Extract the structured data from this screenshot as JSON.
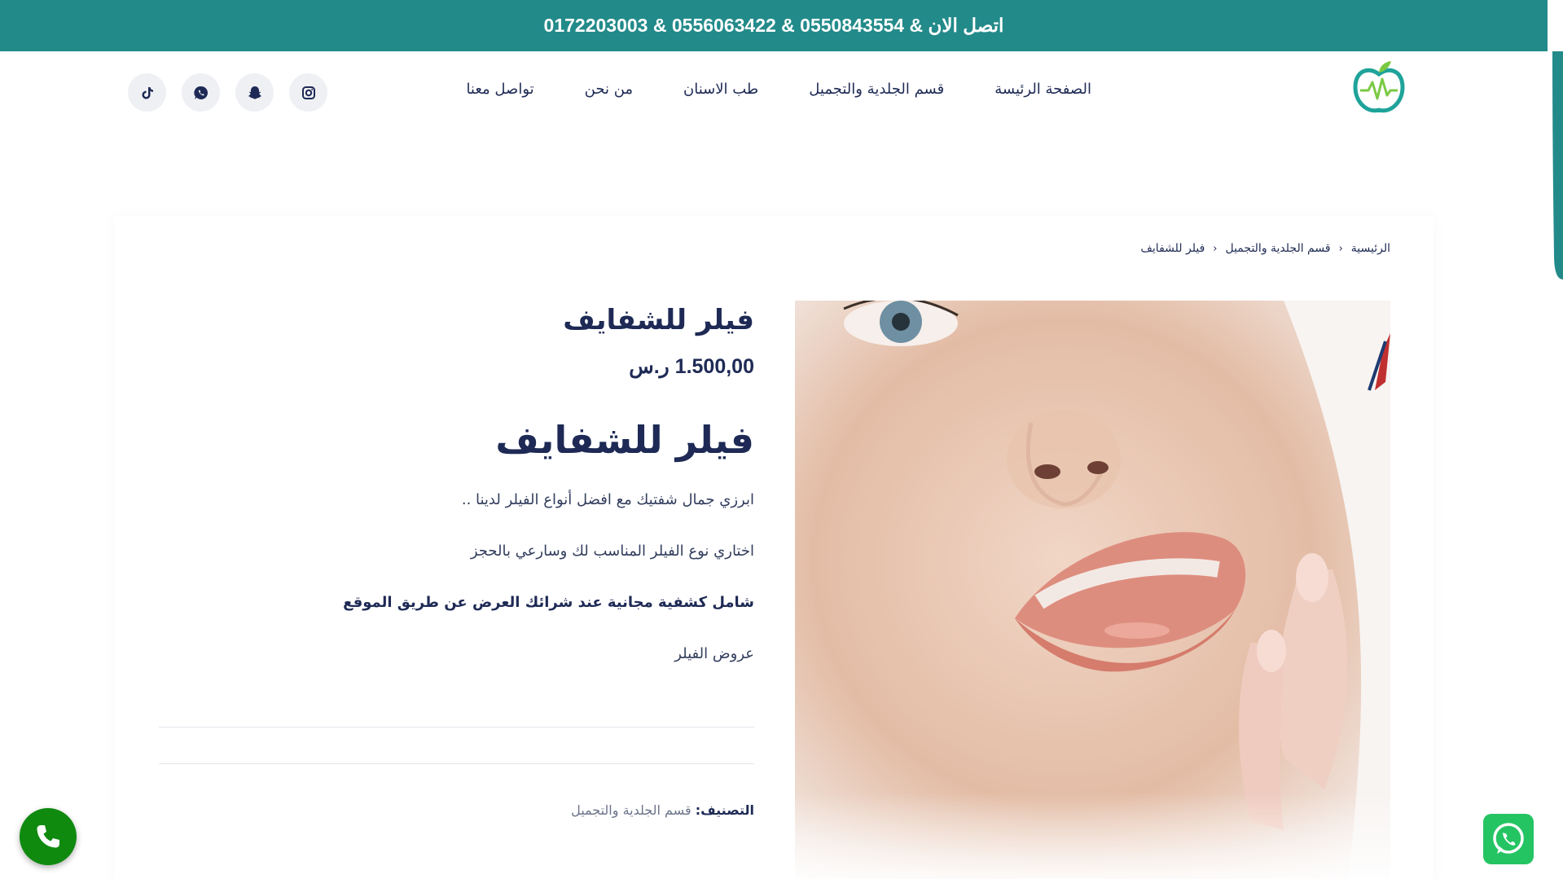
{
  "topbar": {
    "contact_text": "اتصل الان &  0550843554 &  0556063422  &  0172203003"
  },
  "header": {
    "logo_icon": "apple-heartbeat-logo-icon",
    "nav": [
      {
        "label": "الصفحة الرئيسة"
      },
      {
        "label": "قسم الجلدية والتجميل"
      },
      {
        "label": "طب الاسنان"
      },
      {
        "label": "من نحن"
      },
      {
        "label": "تواصل معنا"
      }
    ],
    "socials": [
      "instagram-icon",
      "snapchat-icon",
      "whatsapp-icon",
      "tiktok-icon"
    ]
  },
  "breadcrumb": {
    "home": "الرئيسية",
    "category": "قسم الجلدية والتجميل",
    "current": "فيلر للشفايف"
  },
  "product": {
    "title": "فيلر للشفايف",
    "price": "1.500,00 ر.س",
    "subtitle": "فيلر للشفايف",
    "paragraphs": [
      "ابرزي جمال شفتيك مع افضل أنواع الفيلر لدينا ..",
      "اختاري نوع الفيلر المناسب لك وسارعي بالحجز",
      "شامل كشفية مجانية عند شرائك العرض عن طريق الموقع",
      "عروض الفيلر"
    ],
    "category_label": "التصنيف:",
    "category_value": "قسم الجلدية والتجميل"
  },
  "colors": {
    "topbar": "#238a8a",
    "text": "#1e2a55",
    "call_button": "#0f8a0f",
    "whatsapp_button": "#25c463"
  }
}
